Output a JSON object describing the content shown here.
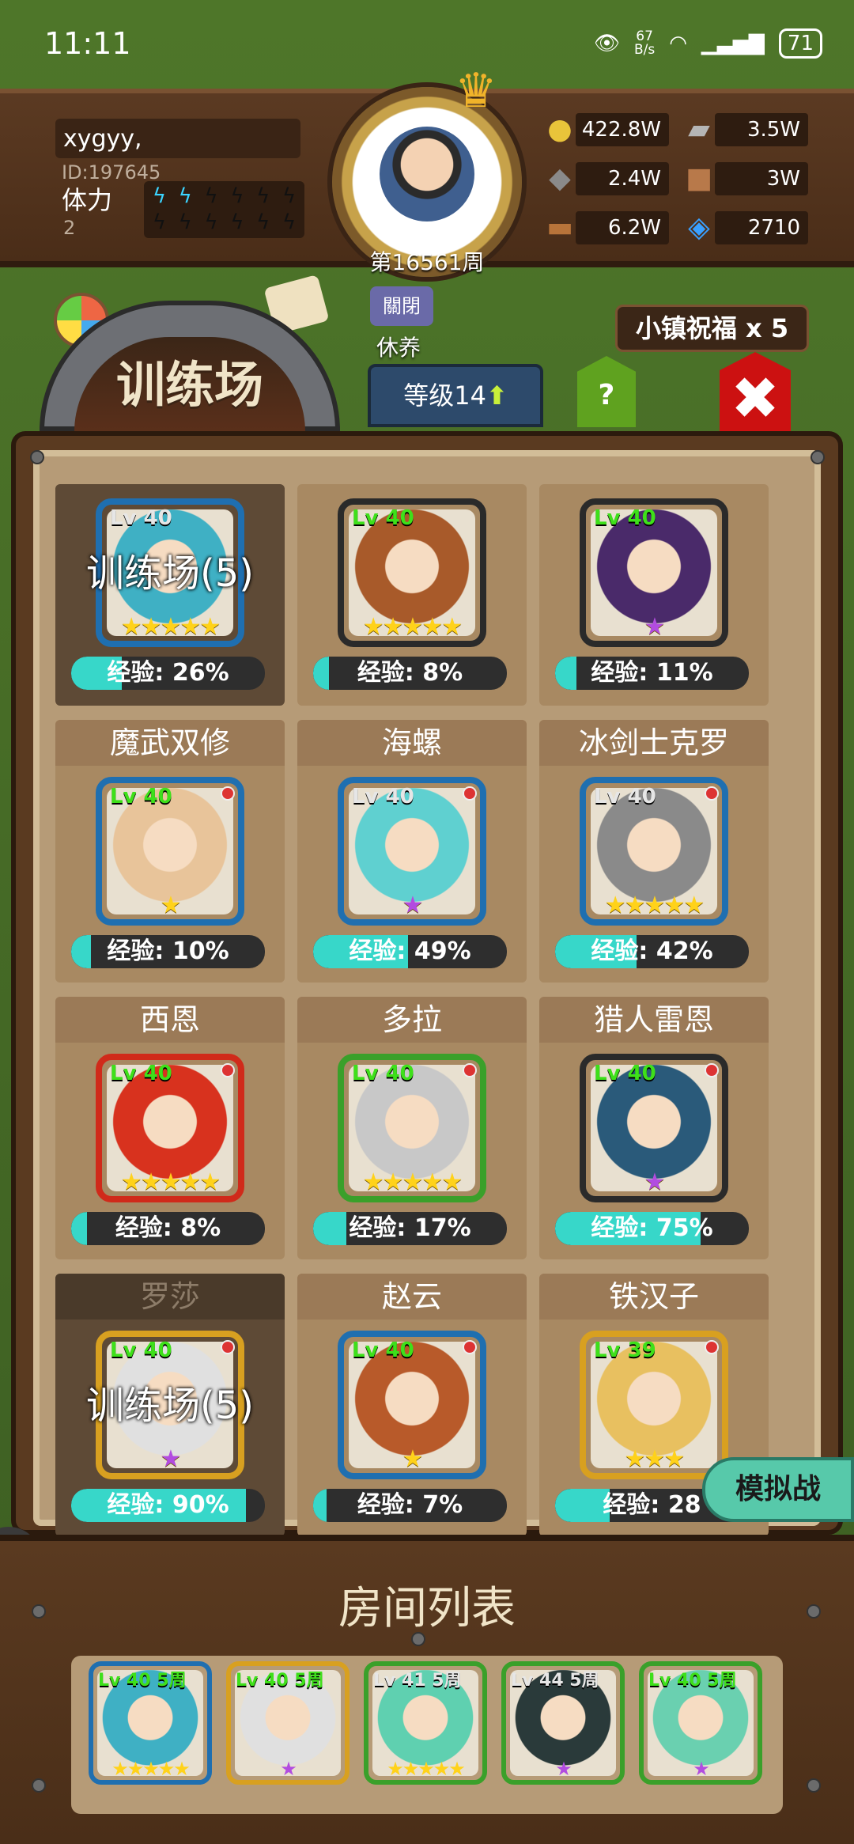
{
  "status_bar": {
    "time": "11:11",
    "net_speed": "67",
    "net_unit": "B/s",
    "battery": "71"
  },
  "player": {
    "name": "xygyy,",
    "id": "ID:197645",
    "stamina_label": "体力",
    "stamina_value": "2",
    "stamina_bolts_filled": 2,
    "week": "第16561周"
  },
  "resources": [
    {
      "icon": "gold-coin-icon",
      "glyph": "●",
      "color": "#e9c43a",
      "value": "422.8W"
    },
    {
      "icon": "iron-ingot-icon",
      "glyph": "▰",
      "color": "#b5b5b5",
      "value": "3.5W"
    },
    {
      "icon": "ore-stone-icon",
      "glyph": "◆",
      "color": "#8a8a8a",
      "value": "2.4W"
    },
    {
      "icon": "leather-icon",
      "glyph": "■",
      "color": "#b8794a",
      "value": "3W"
    },
    {
      "icon": "wood-log-icon",
      "glyph": "▬",
      "color": "#b8743a",
      "value": "6.2W"
    },
    {
      "icon": "crystal-icon",
      "glyph": "◈",
      "color": "#3aa0ff",
      "value": "2710"
    }
  ],
  "nav": {
    "rest_label": "休养",
    "rest_icon_text": "關閉",
    "blessing": "小镇祝福 x 5",
    "title": "训练场",
    "level_tab": "等级14",
    "help": "?",
    "close": "✖"
  },
  "heroes": [
    {
      "name": "",
      "lv": "Lv 40",
      "lv_color": "grey",
      "stars": "★★★★★",
      "star_color": "gold",
      "exp": "经验: 26%",
      "exp_pct": 26,
      "hair": "#3fb0c4",
      "frame": "#1f6fb0",
      "dim": true,
      "overlay": "训练场(5)",
      "dot": false
    },
    {
      "name": "",
      "lv": "Lv 40",
      "lv_color": "green",
      "stars": "★★★★★",
      "star_color": "gold",
      "exp": "经验: 8%",
      "exp_pct": 8,
      "hair": "#a85a2a",
      "frame": "#2a2a2a",
      "dim": false,
      "overlay": "",
      "dot": false
    },
    {
      "name": "",
      "lv": "Lv 40",
      "lv_color": "green",
      "stars": "★",
      "star_color": "purple",
      "exp": "经验: 11%",
      "exp_pct": 11,
      "hair": "#4a2a6a",
      "frame": "#2a2a2a",
      "dim": false,
      "overlay": "",
      "dot": false
    },
    {
      "name": "魔武双修",
      "lv": "Lv 40",
      "lv_color": "green",
      "stars": "★",
      "star_color": "gold",
      "exp": "经验: 10%",
      "exp_pct": 10,
      "hair": "#e8c49a",
      "frame": "#1f6fb0",
      "dim": false,
      "overlay": "",
      "dot": true
    },
    {
      "name": "海螺",
      "lv": "Lv 40",
      "lv_color": "grey",
      "stars": "★",
      "star_color": "purple",
      "exp": "经验: 49%",
      "exp_pct": 49,
      "hair": "#5fd0d0",
      "frame": "#1f6fb0",
      "dim": false,
      "overlay": "",
      "dot": true
    },
    {
      "name": "冰剑士克罗",
      "lv": "Lv 40",
      "lv_color": "grey",
      "stars": "★★★★★",
      "star_color": "gold",
      "exp": "经验: 42%",
      "exp_pct": 42,
      "hair": "#8a8a8a",
      "frame": "#1f6fb0",
      "dim": false,
      "overlay": "",
      "dot": true
    },
    {
      "name": "西恩",
      "lv": "Lv 40",
      "lv_color": "green",
      "stars": "★★★★★",
      "star_color": "gold",
      "exp": "经验: 8%",
      "exp_pct": 8,
      "hair": "#d8321e",
      "frame": "#d02a1a",
      "dim": false,
      "overlay": "",
      "dot": true
    },
    {
      "name": "多拉",
      "lv": "Lv 40",
      "lv_color": "green",
      "stars": "★★★★★",
      "star_color": "gold",
      "exp": "经验: 17%",
      "exp_pct": 17,
      "hair": "#c8c8c8",
      "frame": "#3aa02a",
      "dim": false,
      "overlay": "",
      "dot": true
    },
    {
      "name": "猎人雷恩",
      "lv": "Lv 40",
      "lv_color": "green",
      "stars": "★",
      "star_color": "purple",
      "exp": "经验: 75%",
      "exp_pct": 75,
      "hair": "#2a5a7a",
      "frame": "#2a2a2a",
      "dim": false,
      "overlay": "",
      "dot": true
    },
    {
      "name": "罗莎",
      "lv": "Lv 40",
      "lv_color": "green",
      "stars": "★",
      "star_color": "purple",
      "exp": "经验: 90%",
      "exp_pct": 90,
      "hair": "#e0e0e0",
      "frame": "#d8a020",
      "dim": true,
      "overlay": "训练场(5)",
      "dot": true
    },
    {
      "name": "赵云",
      "lv": "Lv 40",
      "lv_color": "green",
      "stars": "★",
      "star_color": "gold",
      "exp": "经验: 7%",
      "exp_pct": 7,
      "hair": "#b85a2a",
      "frame": "#1f6fb0",
      "dim": false,
      "overlay": "",
      "dot": true
    },
    {
      "name": "铁汉子",
      "lv": "Lv 39",
      "lv_color": "green",
      "stars": "★★★",
      "star_color": "gold",
      "exp": "经验: 28",
      "exp_pct": 28,
      "hair": "#e8c060",
      "frame": "#d8a020",
      "dim": false,
      "overlay": "",
      "dot": true
    }
  ],
  "sim_button": "模拟战",
  "side_tab": "ap",
  "room": {
    "title": "房间列表",
    "slots": [
      {
        "lv": "Lv 40  5周",
        "lv_color": "green",
        "stars": "★★★★★",
        "star_color": "gold",
        "hair": "#3fb0c4",
        "frame": "#1f6fb0"
      },
      {
        "lv": "Lv 40  5周",
        "lv_color": "green",
        "stars": "★",
        "star_color": "purple",
        "hair": "#e0e0e0",
        "frame": "#d8a020"
      },
      {
        "lv": "Lv 41  5周",
        "lv_color": "grey",
        "stars": "★★★★★",
        "star_color": "gold",
        "hair": "#5fd0b0",
        "frame": "#3aa02a"
      },
      {
        "lv": "Lv 44  5周",
        "lv_color": "grey",
        "stars": "★",
        "star_color": "purple",
        "hair": "#2a3a3a",
        "frame": "#3aa02a"
      },
      {
        "lv": "Lv 40  5周",
        "lv_color": "green",
        "stars": "★",
        "star_color": "purple",
        "hair": "#6ad0b0",
        "frame": "#3aa02a"
      }
    ]
  }
}
